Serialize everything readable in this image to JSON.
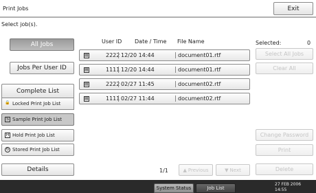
{
  "header": {
    "title": "Print Jobs",
    "exit_label": "Exit"
  },
  "prompt": "Select job(s).",
  "left_buttons": {
    "all_jobs": "All Jobs",
    "jobs_per_user": "Jobs Per User ID",
    "complete_list": "Complete List",
    "locked": "Locked Print Job List",
    "sample": "Sample Print Job List",
    "hold": "Hold Print Job List",
    "stored": "Stored Print Job List",
    "details": "Details"
  },
  "table": {
    "columns": {
      "user_id": "User ID",
      "datetime": "Date / Time",
      "file_name": "File Name"
    },
    "rows": [
      {
        "user_id": "2222",
        "datetime": "12/20 14:44",
        "file_name": "document01.rtf"
      },
      {
        "user_id": "1111",
        "datetime": "12/20 14:44",
        "file_name": "document01.rtf"
      },
      {
        "user_id": "2222",
        "datetime": "02/27 11:45",
        "file_name": "document02.rtf"
      },
      {
        "user_id": "1111",
        "datetime": "02/27 11:44",
        "file_name": "document02.rtf"
      }
    ]
  },
  "pagination": {
    "page": "1/1",
    "previous": "Previous",
    "next": "Next"
  },
  "right_panel": {
    "selected_label": "Selected:",
    "selected_count": "0",
    "select_all": "Select All Jobs",
    "clear_all": "Clear All",
    "change_password": "Change Password",
    "print": "Print",
    "delete": "Delete"
  },
  "status_bar": {
    "system_status": "System Status",
    "job_list": "Job List",
    "date": "27 FEB  2006",
    "time": "14:55"
  }
}
